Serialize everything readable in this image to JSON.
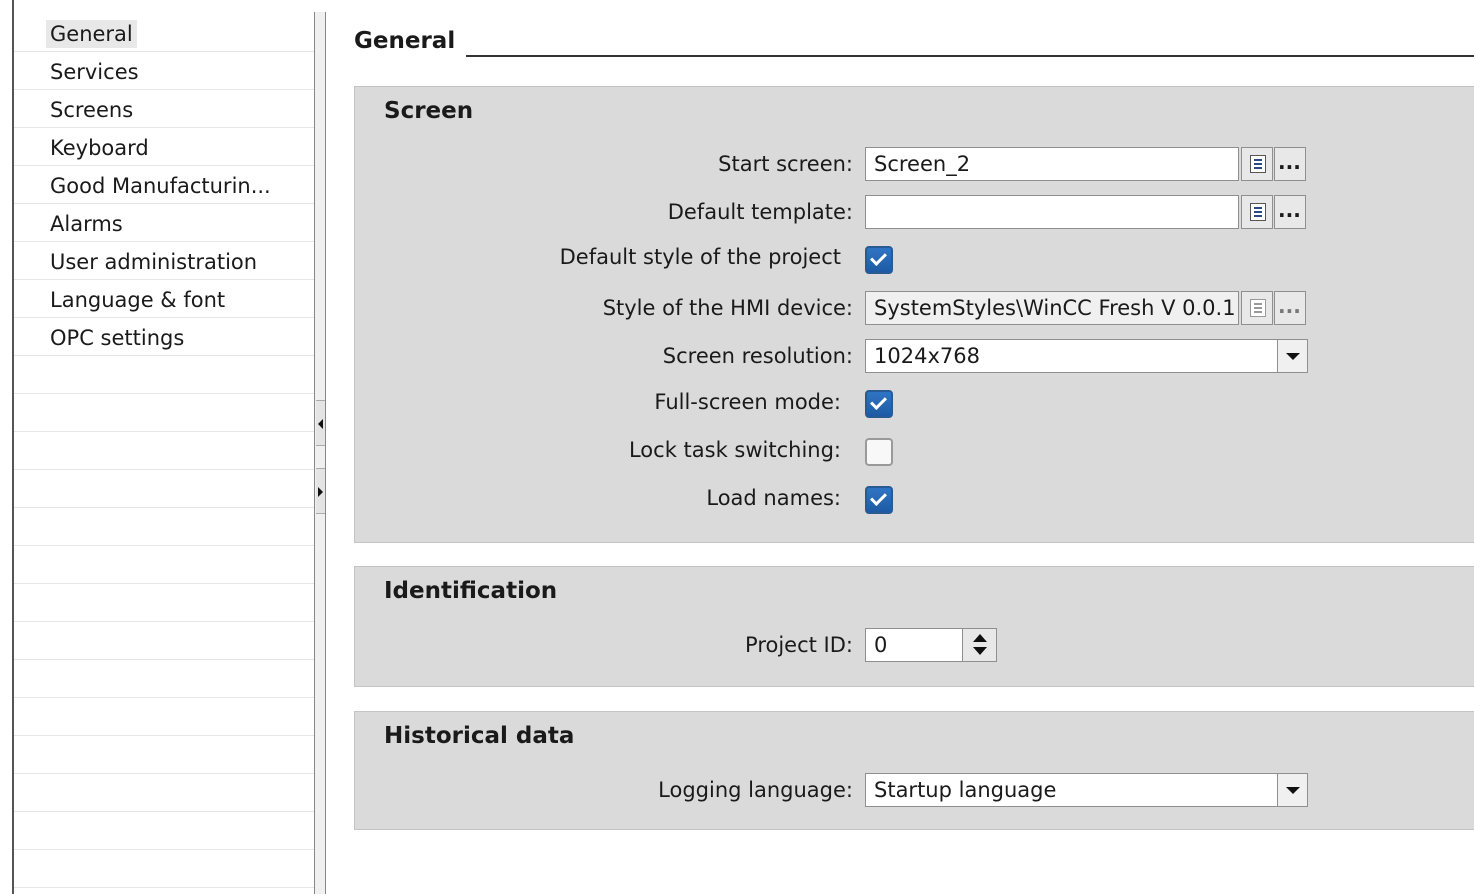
{
  "sidebar": {
    "items": [
      {
        "label": "General",
        "selected": true
      },
      {
        "label": "Services"
      },
      {
        "label": "Screens"
      },
      {
        "label": "Keyboard"
      },
      {
        "label": "Good Manufacturin..."
      },
      {
        "label": "Alarms"
      },
      {
        "label": "User administration"
      },
      {
        "label": "Language & font"
      },
      {
        "label": "OPC settings"
      }
    ]
  },
  "main": {
    "title": "General",
    "screen_group": {
      "title": "Screen",
      "start_screen": {
        "label": "Start screen:",
        "value": "Screen_2"
      },
      "default_template": {
        "label": "Default template:",
        "value": ""
      },
      "default_style": {
        "label": "Default style of the project",
        "checked": true
      },
      "hmi_style": {
        "label": "Style of the HMI device:",
        "value": "SystemStyles\\WinCC Fresh V 0.0.1",
        "disabled": true
      },
      "screen_resolution": {
        "label": "Screen resolution:",
        "value": "1024x768"
      },
      "full_screen": {
        "label": "Full-screen mode:",
        "checked": true
      },
      "lock_task": {
        "label": "Lock task switching:",
        "checked": false
      },
      "load_names": {
        "label": "Load names:",
        "checked": true
      }
    },
    "identification_group": {
      "title": "Identification",
      "project_id": {
        "label": "Project ID:",
        "value": "0"
      }
    },
    "historical_group": {
      "title": "Historical data",
      "logging_language": {
        "label": "Logging language:",
        "value": "Startup language"
      }
    }
  },
  "icons": {
    "browse": "...",
    "list": "list-icon"
  },
  "colors": {
    "group_bg": "#dadada",
    "checkbox_checked": "#2f74c4"
  }
}
